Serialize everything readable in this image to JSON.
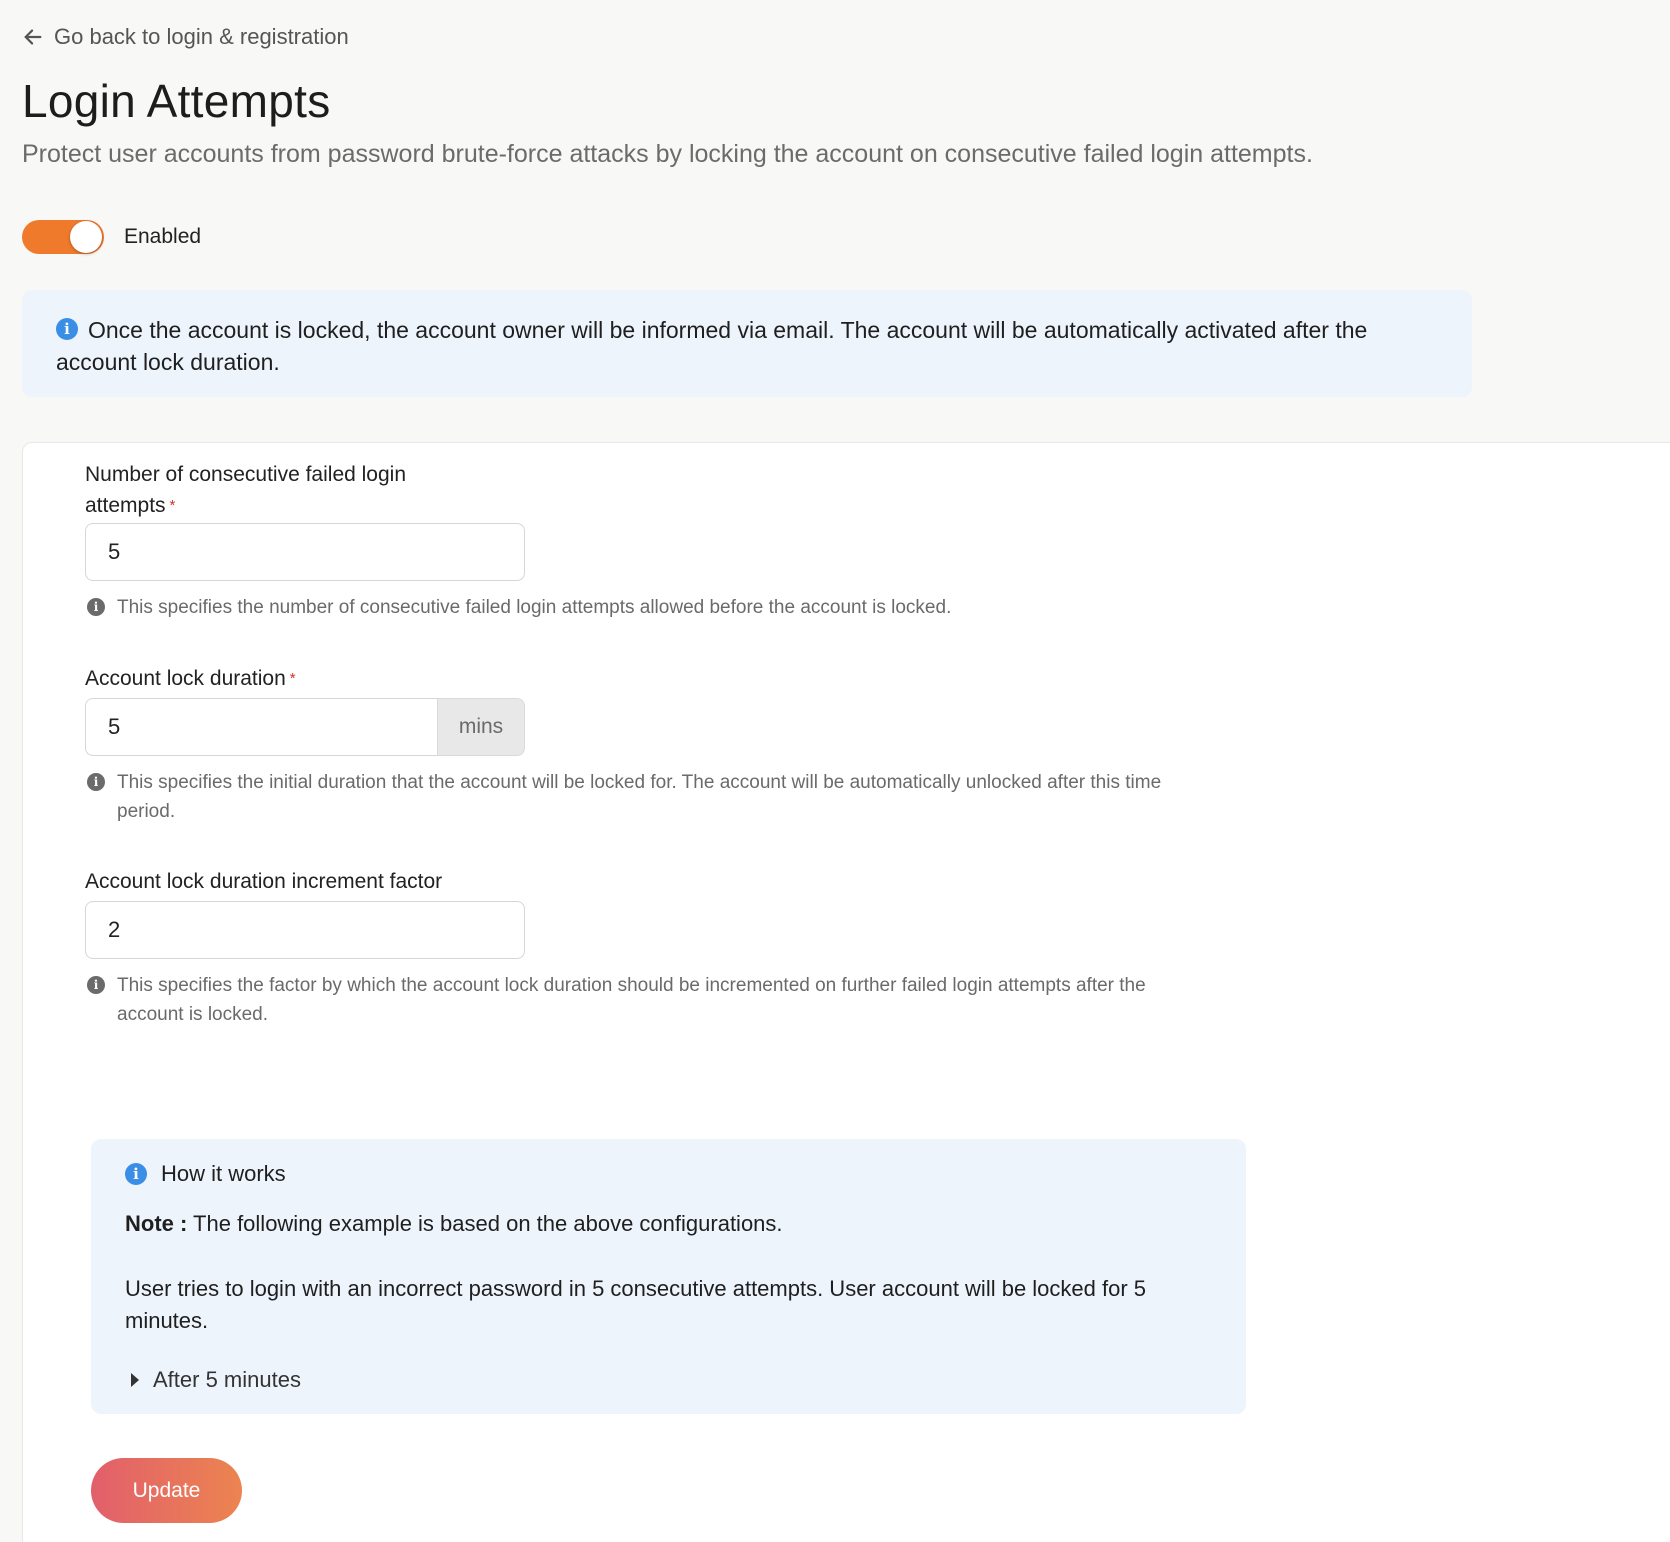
{
  "back_link": {
    "label": "Go back to login & registration",
    "icon": "arrow-left-icon"
  },
  "header": {
    "title": "Login Attempts",
    "subtitle": "Protect user accounts from password brute-force attacks by locking the account on consecutive failed login attempts."
  },
  "toggle": {
    "label": "Enabled",
    "state": true,
    "color": "#f07a2c"
  },
  "banner": {
    "icon": "info-icon",
    "text": "Once the account is locked, the account owner will be informed via email. The account will be automatically activated after the account lock duration."
  },
  "form": {
    "attempts": {
      "label": "Number of consecutive failed login attempts",
      "required_mark": "*",
      "value": "5",
      "hint": "This specifies the number of consecutive failed login attempts allowed before the account is locked."
    },
    "lock_duration": {
      "label": "Account lock duration",
      "required_mark": "*",
      "value": "5",
      "unit": "mins",
      "hint": "This specifies the initial duration that the account will be locked for. The account will be automatically unlocked after this time period."
    },
    "increment_factor": {
      "label": "Account lock duration increment factor",
      "value": "2",
      "hint": "This specifies the factor by which the account lock duration should be incremented on further failed login attempts after the account is locked."
    }
  },
  "how_it_works": {
    "title": "How it works",
    "note_label": "Note :",
    "note_text": " The following example is based on the above configurations.",
    "description": "User tries to login with an incorrect password in 5 consecutive attempts. User account will be locked for 5 minutes.",
    "collapsible_label": "After 5 minutes"
  },
  "actions": {
    "update_label": "Update"
  },
  "colors": {
    "accent": "#f07a2c",
    "info_blue": "#3a8ee6",
    "banner_bg": "#edf4fc",
    "button_gradient_start": "#e25f6b",
    "button_gradient_end": "#ec8450"
  }
}
